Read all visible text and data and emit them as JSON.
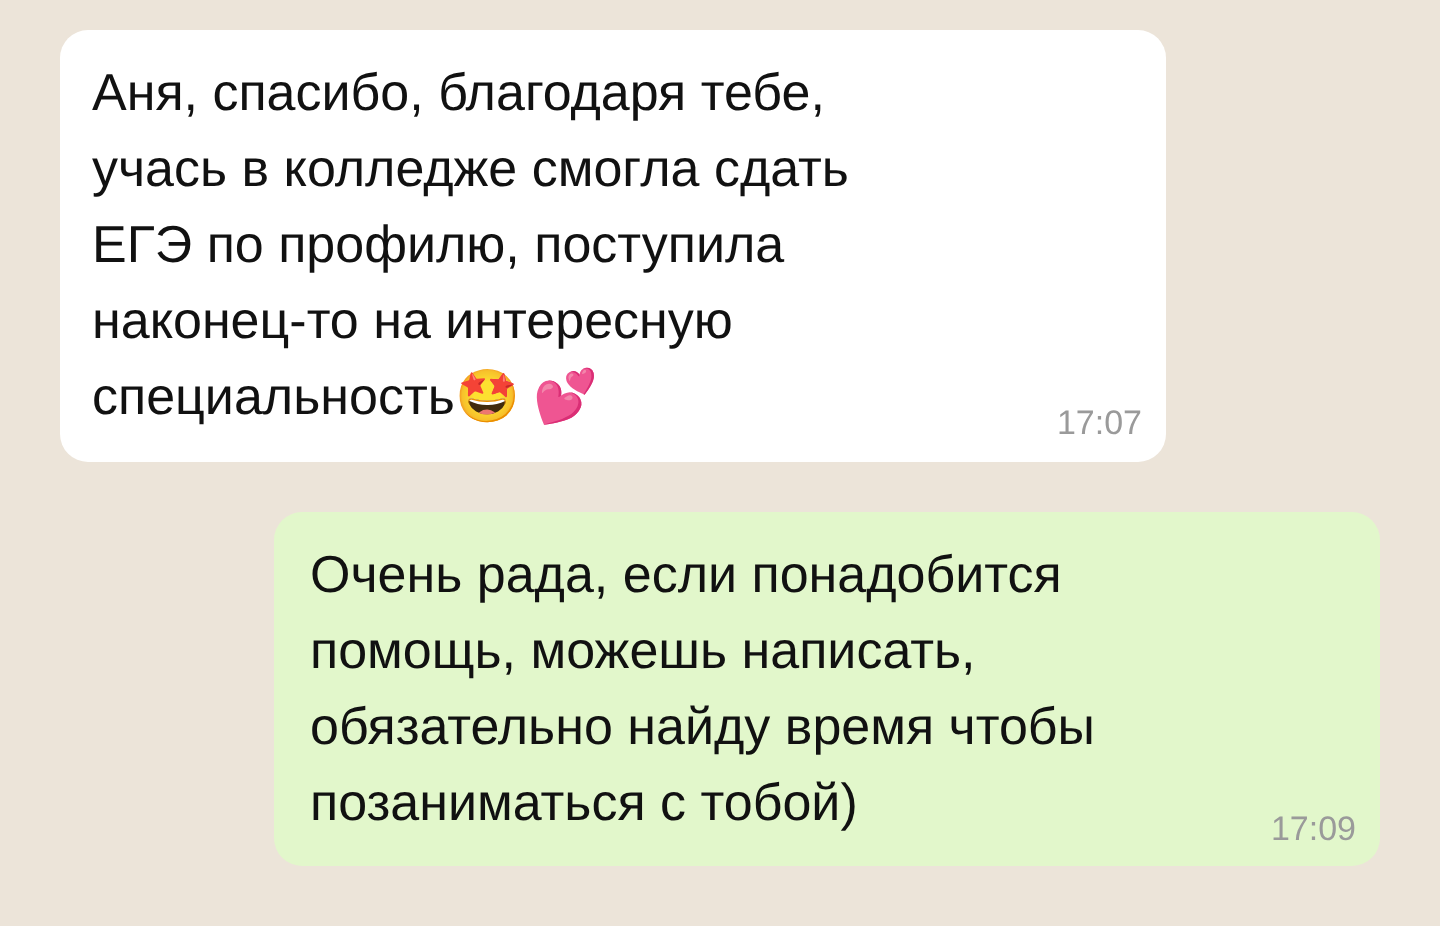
{
  "messages": [
    {
      "kind": "incoming",
      "text": "Аня, спасибо, благодаря тебе,\nучась в колледже смогла сдать\nЕГЭ по профилю, поступила\nнаконец-то на интересную\nспециальность🤩 💕",
      "time": "17:07"
    },
    {
      "kind": "outgoing",
      "text": "Очень рада, если понадобится\nпомощь, можешь написать,\nобязательно найду время чтобы\nпозаниматься с тобой)",
      "time": "17:09"
    }
  ]
}
